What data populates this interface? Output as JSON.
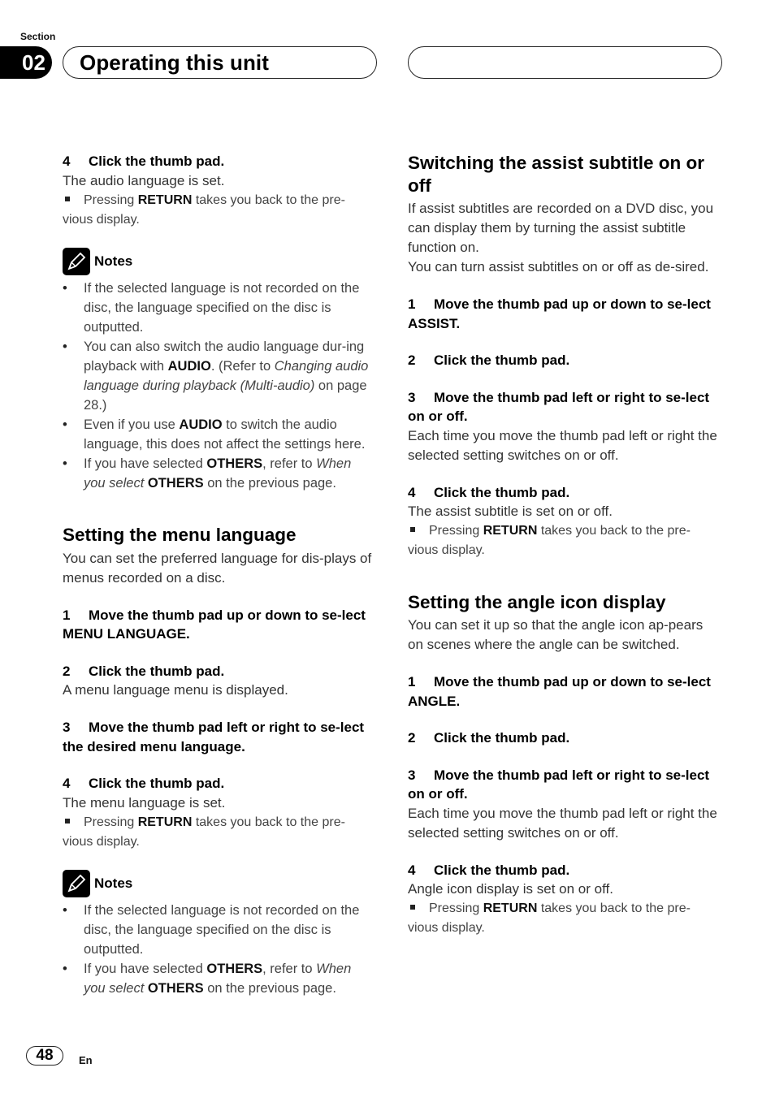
{
  "header": {
    "section_label": "Section",
    "section_number": "02",
    "title": "Operating this unit"
  },
  "left": {
    "step4a": {
      "num": "4",
      "text": "Click the thumb pad."
    },
    "step4a_result": "The audio language is set.",
    "return_note_a": {
      "pre": "Pressing ",
      "bold": "RETURN",
      "post": " takes you back to the pre-vious display."
    },
    "notes_a": {
      "label": "Notes",
      "items": [
        {
          "text": "If the selected language is not recorded on the disc, the language specified on the disc is outputted."
        },
        {
          "t1": "You can also switch the audio language dur-ing playback with ",
          "b1": "AUDIO",
          "t2": ". (Refer to ",
          "i1": "Changing audio language during playback (Multi-audio)",
          "t3": " on page 28.)"
        },
        {
          "t1": "Even if you use ",
          "b1": "AUDIO",
          "t2": " to switch the audio language, this does not affect the settings here."
        },
        {
          "t1": "If you have selected ",
          "b1": "OTHERS",
          "t2": ", refer to ",
          "i1": "When you select",
          "t3": " ",
          "b2": "OTHERS",
          "t4": " on the previous page."
        }
      ]
    },
    "menu_lang": {
      "heading": "Setting the menu language",
      "intro": "You can set the preferred language for dis-plays of menus recorded on a disc.",
      "step1": {
        "num": "1",
        "text": "Move the thumb pad up or down to se-lect MENU LANGUAGE."
      },
      "step2": {
        "num": "2",
        "text": "Click the thumb pad."
      },
      "step2_result": "A menu language menu is displayed.",
      "step3": {
        "num": "3",
        "text": "Move the thumb pad left or right to se-lect the desired menu language."
      },
      "step4": {
        "num": "4",
        "text": "Click the thumb pad."
      },
      "step4_result": "The menu language is set.",
      "return_note": {
        "pre": "Pressing ",
        "bold": "RETURN",
        "post": " takes you back to the pre-vious display."
      }
    },
    "notes_b": {
      "label": "Notes",
      "items": [
        {
          "text": "If the selected language is not recorded on the disc, the language specified on the disc is outputted."
        },
        {
          "t1": "If you have selected ",
          "b1": "OTHERS",
          "t2": ", refer to ",
          "i1": "When you select",
          "t3": " ",
          "b2": "OTHERS",
          "t4": " on the previous page."
        }
      ]
    }
  },
  "right": {
    "assist": {
      "heading": "Switching the assist subtitle on or off",
      "intro1": "If assist subtitles are recorded on a DVD disc, you can display them by turning the assist subtitle function on.",
      "intro2": "You can turn assist subtitles on or off as de-sired.",
      "step1": {
        "num": "1",
        "text": "Move the thumb pad up or down to se-lect ASSIST."
      },
      "step2": {
        "num": "2",
        "text": "Click the thumb pad."
      },
      "step3": {
        "num": "3",
        "text": "Move the thumb pad left or right to se-lect on or off."
      },
      "step3_result": "Each time you move the thumb pad left or right the selected setting switches on or off.",
      "step4": {
        "num": "4",
        "text": "Click the thumb pad."
      },
      "step4_result": "The assist subtitle is set on or off.",
      "return_note": {
        "pre": "Pressing ",
        "bold": "RETURN",
        "post": " takes you back to the pre-vious display."
      }
    },
    "angle": {
      "heading": "Setting the angle icon display",
      "intro": "You can set it up so that the angle icon ap-pears on scenes where the angle can be switched.",
      "step1": {
        "num": "1",
        "text": "Move the thumb pad up or down to se-lect ANGLE."
      },
      "step2": {
        "num": "2",
        "text": "Click the thumb pad."
      },
      "step3": {
        "num": "3",
        "text": "Move the thumb pad left or right to se-lect on or off."
      },
      "step3_result": "Each time you move the thumb pad left or right the selected setting switches on or off.",
      "step4": {
        "num": "4",
        "text": "Click the thumb pad."
      },
      "step4_result": "Angle icon display is set on or off.",
      "return_note": {
        "pre": "Pressing ",
        "bold": "RETURN",
        "post": " takes you back to the pre-vious display."
      }
    }
  },
  "footer": {
    "page_number": "48",
    "language": "En"
  }
}
